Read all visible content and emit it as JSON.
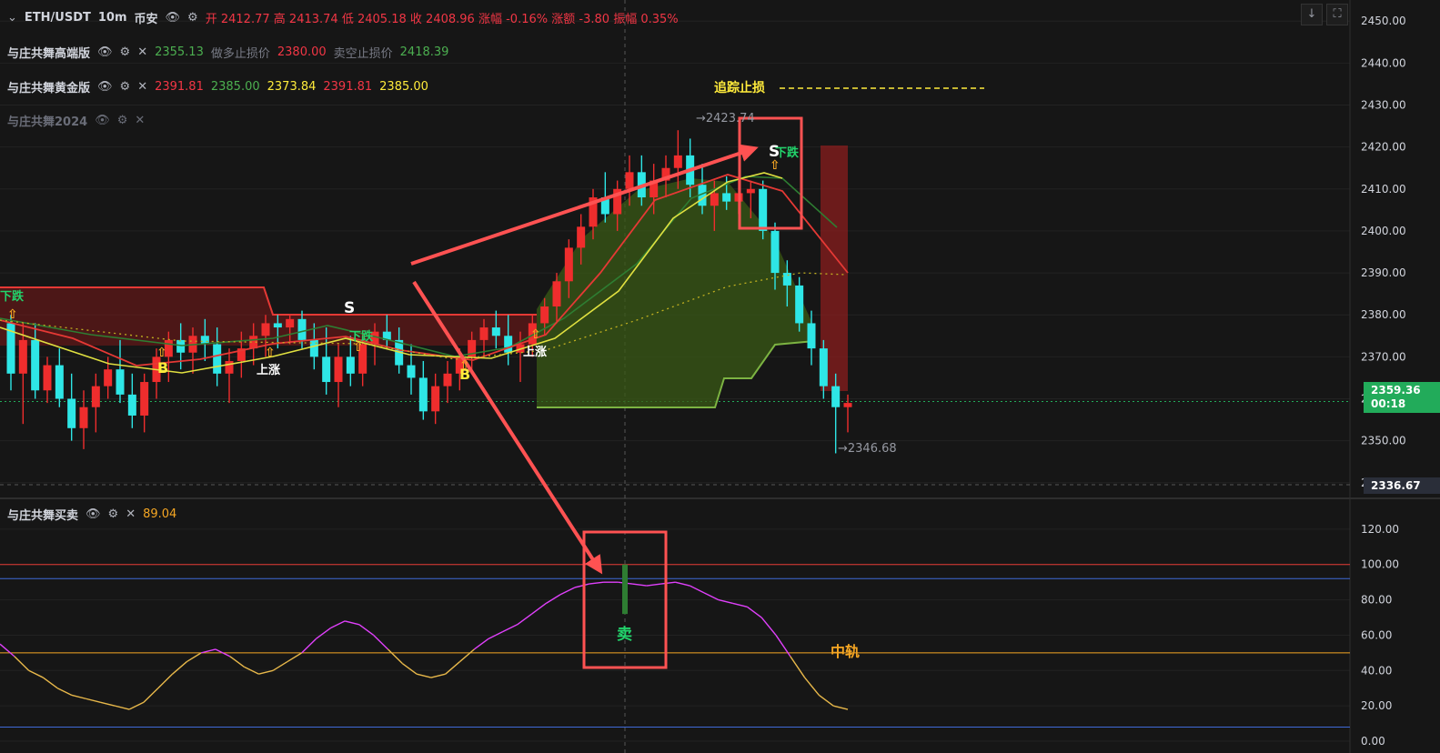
{
  "header": {
    "symbol": "ETH/USDT",
    "interval": "10m",
    "exchange": "币安",
    "ohlc": {
      "open_label": "开",
      "open": "2412.77",
      "high_label": "高",
      "high": "2413.74",
      "low_label": "低",
      "low": "2405.18",
      "close_label": "收",
      "close": "2408.96",
      "chg_pct_label": "涨幅",
      "chg_pct": "-0.16%",
      "chg_label": "涨额",
      "chg": "-3.80",
      "amp_label": "振幅",
      "amp": "0.35%"
    }
  },
  "indicators": [
    {
      "name": "与庄共舞高端版",
      "values": [
        {
          "text": "2355.13",
          "color": "#4caf50"
        },
        {
          "text": "做多止损价",
          "color": "#787b86"
        },
        {
          "text": "2380.00",
          "color": "#f23645"
        },
        {
          "text": "卖空止损价",
          "color": "#787b86"
        },
        {
          "text": "2418.39",
          "color": "#4caf50"
        }
      ]
    },
    {
      "name": "与庄共舞黄金版",
      "values": [
        {
          "text": "2391.81",
          "color": "#f23645"
        },
        {
          "text": "2385.00",
          "color": "#4caf50"
        },
        {
          "text": "2373.84",
          "color": "#ffeb3b"
        },
        {
          "text": "2391.81",
          "color": "#f23645"
        },
        {
          "text": "2385.00",
          "color": "#ffeb3b"
        }
      ]
    },
    {
      "name": "与庄共舞2024",
      "values": []
    }
  ],
  "sub_indicator": {
    "name": "与庄共舞买卖",
    "value": "89.04"
  },
  "annotations": {
    "trail_stop": "追踪止损",
    "high_marker": "→2423.74",
    "low_marker": "→2346.68",
    "sell_label": "卖",
    "mid_rail": "中轨",
    "signal_s": "S",
    "signal_b": "B",
    "down_label": "下跌",
    "up_label": "上涨"
  },
  "price_axis": {
    "ticks": [
      "2450.00",
      "2440.00",
      "2430.00",
      "2420.00",
      "2410.00",
      "2400.00",
      "2390.00",
      "2380.00",
      "2370.00",
      "2360.00",
      "2350.00",
      "2340.00"
    ],
    "last_price": "2359.36",
    "countdown": "00:18",
    "crosshair_price": "2336.67"
  },
  "osc_axis": {
    "ticks": [
      "120.00",
      "100.00",
      "80.00",
      "60.00",
      "40.00",
      "20.00",
      "0.00"
    ]
  },
  "colors": {
    "up": "#ef2d2d",
    "down": "#2ee6e6",
    "bg": "#161616",
    "osc_high": "#e040fb",
    "osc_low": "#e8b84a",
    "box": "#ff5252"
  },
  "chart_data": {
    "type": "candlestick",
    "price_range": [
      2338,
      2452
    ],
    "osc_range": [
      0,
      122
    ],
    "candles_ohlc": [
      [
        2378,
        2380,
        2362,
        2366
      ],
      [
        2366,
        2378,
        2354,
        2374
      ],
      [
        2374,
        2378,
        2360,
        2362
      ],
      [
        2362,
        2370,
        2359,
        2368
      ],
      [
        2368,
        2372,
        2358,
        2360
      ],
      [
        2360,
        2366,
        2350,
        2353
      ],
      [
        2353,
        2362,
        2348,
        2358
      ],
      [
        2358,
        2366,
        2352,
        2363
      ],
      [
        2363,
        2370,
        2360,
        2367
      ],
      [
        2367,
        2374,
        2359,
        2361
      ],
      [
        2361,
        2366,
        2353,
        2356
      ],
      [
        2356,
        2366,
        2352,
        2364
      ],
      [
        2364,
        2372,
        2360,
        2370
      ],
      [
        2370,
        2376,
        2364,
        2374
      ],
      [
        2374,
        2378,
        2367,
        2371
      ],
      [
        2371,
        2377,
        2366,
        2375
      ],
      [
        2375,
        2379,
        2369,
        2373
      ],
      [
        2373,
        2377,
        2363,
        2366
      ],
      [
        2366,
        2372,
        2359,
        2369
      ],
      [
        2369,
        2376,
        2365,
        2372
      ],
      [
        2372,
        2378,
        2368,
        2375
      ],
      [
        2375,
        2380,
        2370,
        2378
      ],
      [
        2378,
        2380,
        2372,
        2377
      ],
      [
        2377,
        2380,
        2373,
        2379
      ],
      [
        2379,
        2381,
        2372,
        2374
      ],
      [
        2374,
        2378,
        2367,
        2370
      ],
      [
        2370,
        2377,
        2361,
        2364
      ],
      [
        2364,
        2373,
        2358,
        2370
      ],
      [
        2370,
        2375,
        2363,
        2366
      ],
      [
        2366,
        2376,
        2363,
        2373
      ],
      [
        2373,
        2378,
        2368,
        2376
      ],
      [
        2376,
        2380,
        2372,
        2374
      ],
      [
        2374,
        2377,
        2366,
        2368
      ],
      [
        2368,
        2373,
        2361,
        2365
      ],
      [
        2365,
        2369,
        2355,
        2357
      ],
      [
        2357,
        2366,
        2354,
        2363
      ],
      [
        2363,
        2369,
        2359,
        2366
      ],
      [
        2366,
        2372,
        2362,
        2370
      ],
      [
        2370,
        2376,
        2366,
        2374
      ],
      [
        2374,
        2379,
        2370,
        2377
      ],
      [
        2377,
        2381,
        2372,
        2375
      ],
      [
        2375,
        2380,
        2368,
        2371
      ],
      [
        2371,
        2376,
        2364,
        2373
      ],
      [
        2373,
        2380,
        2370,
        2378
      ],
      [
        2378,
        2384,
        2375,
        2382
      ],
      [
        2382,
        2390,
        2378,
        2388
      ],
      [
        2388,
        2398,
        2384,
        2396
      ],
      [
        2396,
        2404,
        2392,
        2401
      ],
      [
        2401,
        2410,
        2398,
        2408
      ],
      [
        2408,
        2414,
        2402,
        2404
      ],
      [
        2404,
        2412,
        2400,
        2410
      ],
      [
        2410,
        2418,
        2406,
        2414
      ],
      [
        2414,
        2418,
        2406,
        2408
      ],
      [
        2408,
        2416,
        2404,
        2412
      ],
      [
        2412,
        2418,
        2408,
        2415
      ],
      [
        2415,
        2424,
        2410,
        2418
      ],
      [
        2418,
        2422,
        2408,
        2411
      ],
      [
        2411,
        2416,
        2404,
        2406
      ],
      [
        2406,
        2412,
        2400,
        2409
      ],
      [
        2409,
        2413,
        2405,
        2407
      ],
      [
        2407,
        2413,
        2404,
        2409
      ],
      [
        2409,
        2412,
        2403,
        2410
      ],
      [
        2410,
        2412,
        2398,
        2400
      ],
      [
        2400,
        2402,
        2386,
        2390
      ],
      [
        2390,
        2393,
        2382,
        2387
      ],
      [
        2387,
        2389,
        2376,
        2378
      ],
      [
        2378,
        2381,
        2368,
        2372
      ],
      [
        2372,
        2374,
        2360,
        2363
      ],
      [
        2363,
        2366,
        2347,
        2358
      ],
      [
        2358,
        2361,
        2352,
        2359
      ]
    ],
    "oscillator": [
      55,
      48,
      40,
      36,
      30,
      26,
      24,
      22,
      20,
      18,
      22,
      30,
      38,
      45,
      50,
      52,
      48,
      42,
      38,
      40,
      45,
      50,
      58,
      64,
      68,
      66,
      60,
      52,
      44,
      38,
      36,
      38,
      45,
      52,
      58,
      62,
      66,
      72,
      78,
      83,
      87,
      89,
      90,
      90,
      89,
      88,
      89,
      90,
      88,
      84,
      80,
      78,
      76,
      70,
      60,
      48,
      36,
      26,
      20,
      18
    ]
  }
}
